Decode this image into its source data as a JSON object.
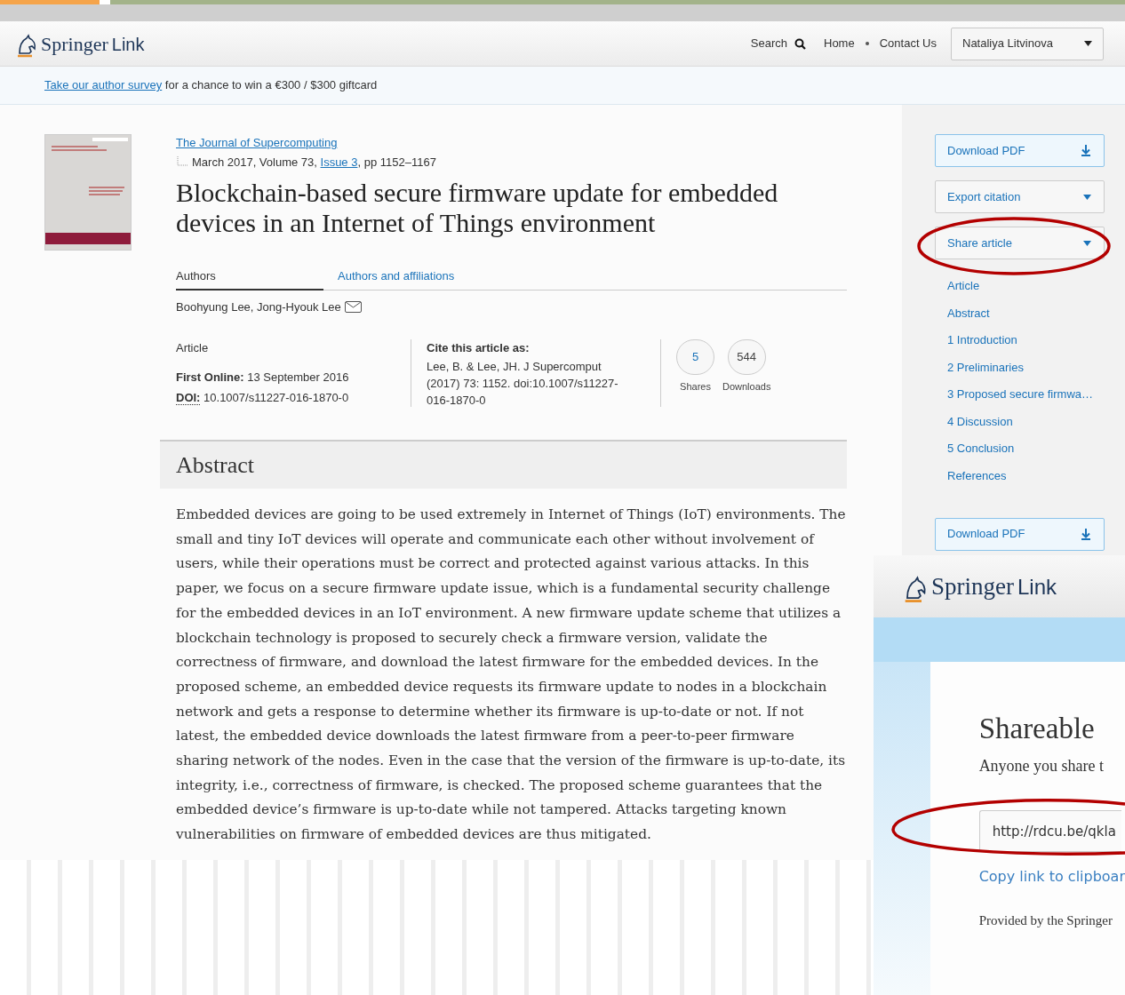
{
  "header": {
    "logo": {
      "primary": "Springer",
      "secondary": "Link"
    },
    "nav": [
      {
        "kind": "search",
        "label": "Search"
      },
      {
        "kind": "link",
        "label": "Home"
      },
      {
        "kind": "link",
        "label": "Contact Us"
      }
    ],
    "user_menu": "Nataliya Litvinova"
  },
  "survey_bar": {
    "link": "Take our author survey",
    "text": "for a chance to win a €300 / $300 giftcard"
  },
  "article": {
    "journal": "The Journal of Supercomputing",
    "issue_prefix": "March 2017, Volume 73,",
    "issue_link": "Issue 3",
    "issue_suffix": ", pp 1152–1167",
    "title": "Blockchain-based secure firmware update for embedded devices in an Internet of Things environment",
    "tabs": [
      {
        "label": "Authors",
        "selected": true
      },
      {
        "label": "Authors and affiliations",
        "selected": false
      }
    ],
    "authors": "Boohyung Lee, Jong-Hyouk Lee",
    "type": "Article",
    "first_online_label": "First Online:",
    "first_online": "13 September 2016",
    "doi_label": "DOI:",
    "doi": "10.1007/s11227-016-1870-0",
    "cite_label": "Cite this article as:",
    "cite_text": "Lee, B. & Lee, JH. J Supercomput (2017) 73: 1152. doi:10.1007/s11227-016-1870-0",
    "metrics": [
      {
        "value": "5",
        "label": "Shares",
        "kind": "link"
      },
      {
        "value": "544",
        "label": "Downloads",
        "kind": "plain"
      }
    ],
    "abstract_heading": "Abstract",
    "abstract": "Embedded devices are going to be used extremely in Internet of Things (IoT) environments. The small and tiny IoT devices will operate and communicate each other without involvement of users, while their operations must be correct and protected against various attacks. In this paper, we focus on a secure firmware update issue, which is a fundamental security challenge for the embedded devices in an IoT environment. A new firmware update scheme that utilizes a blockchain technology is proposed to securely check a firmware version, validate the correctness of firmware, and download the latest firmware for the embedded devices. In the proposed scheme, an embedded device requests its firmware update to nodes in a blockchain network and gets a response to determine whether its firmware is up-to-date or not. If not latest, the embedded device downloads the latest firmware from a peer-to-peer firmware sharing network of the nodes. Even in the case that the version of the firmware is up-to-date, its integrity, i.e., correctness of firmware, is checked. The proposed scheme guarantees that the embedded device’s firmware is up-to-date while not tampered. Attacks targeting known vulnerabilities on firmware of embedded devices are thus mitigated."
  },
  "sidebar": {
    "buttons": [
      {
        "kind": "download",
        "label": "Download PDF"
      },
      {
        "kind": "dropdown",
        "label": "Export citation"
      },
      {
        "kind": "dropdown",
        "label": "Share article"
      }
    ],
    "contents": [
      "Article",
      "Abstract",
      "1 Introduction",
      "2 Preliminaries",
      "3 Proposed secure firmwa…",
      "4 Discussion",
      "5 Conclusion",
      "References"
    ],
    "bottom_button": {
      "kind": "download",
      "label": "Download PDF"
    }
  },
  "share_window": {
    "logo": {
      "primary": "Springer",
      "secondary": "Link"
    },
    "heading": "Shareable",
    "text": "Anyone you share t",
    "link_value": "http://rdcu.be/qkla",
    "copy_link": "Copy link to clipboar",
    "footer": "Provided by the Springer"
  }
}
